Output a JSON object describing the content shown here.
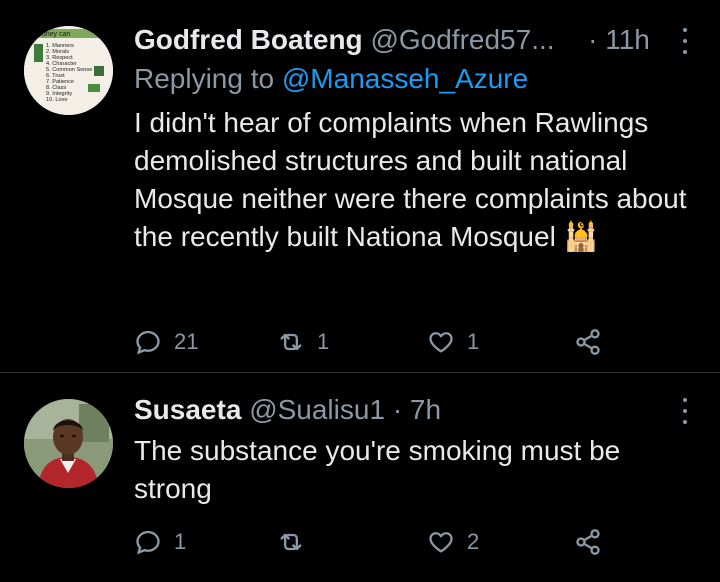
{
  "tweets": [
    {
      "name": "Godfred Boateng",
      "handle": "@Godfred57...",
      "dot": "·",
      "time": "11h",
      "replying_prefix": "Replying to ",
      "replying_to": "@Manasseh_Azure",
      "text": "I didn't hear of complaints when Rawlings demolished structures and built national Mosque neither were there complaints about the recently built Nationa Mosquel",
      "emoji": "🕌",
      "replies": "21",
      "retweets": "1",
      "likes": "1",
      "avatar_lines": [
        "money can",
        "1. Manners",
        "2. Morals",
        "3. Respect",
        "4. Character",
        "5. Common Sense",
        "6. Trust",
        "7. Patience",
        "8. Class",
        "9. Integrity",
        "10. Love"
      ]
    },
    {
      "name": "Susaeta",
      "handle": "@Sualisu1",
      "dot": "·",
      "time": "7h",
      "text": "The substance you're smoking must be strong",
      "replies": "1",
      "retweets": "",
      "likes": "2"
    }
  ],
  "colors": {
    "background": "#000000",
    "text": "#e7e9ea",
    "secondary": "#8b98a5",
    "link": "#1d9bf0",
    "separator": "#2f3336"
  },
  "icons": {
    "reply": "reply-icon",
    "retweet": "retweet-icon",
    "like": "heart-icon",
    "share": "share-icon",
    "more": "more-icon"
  }
}
